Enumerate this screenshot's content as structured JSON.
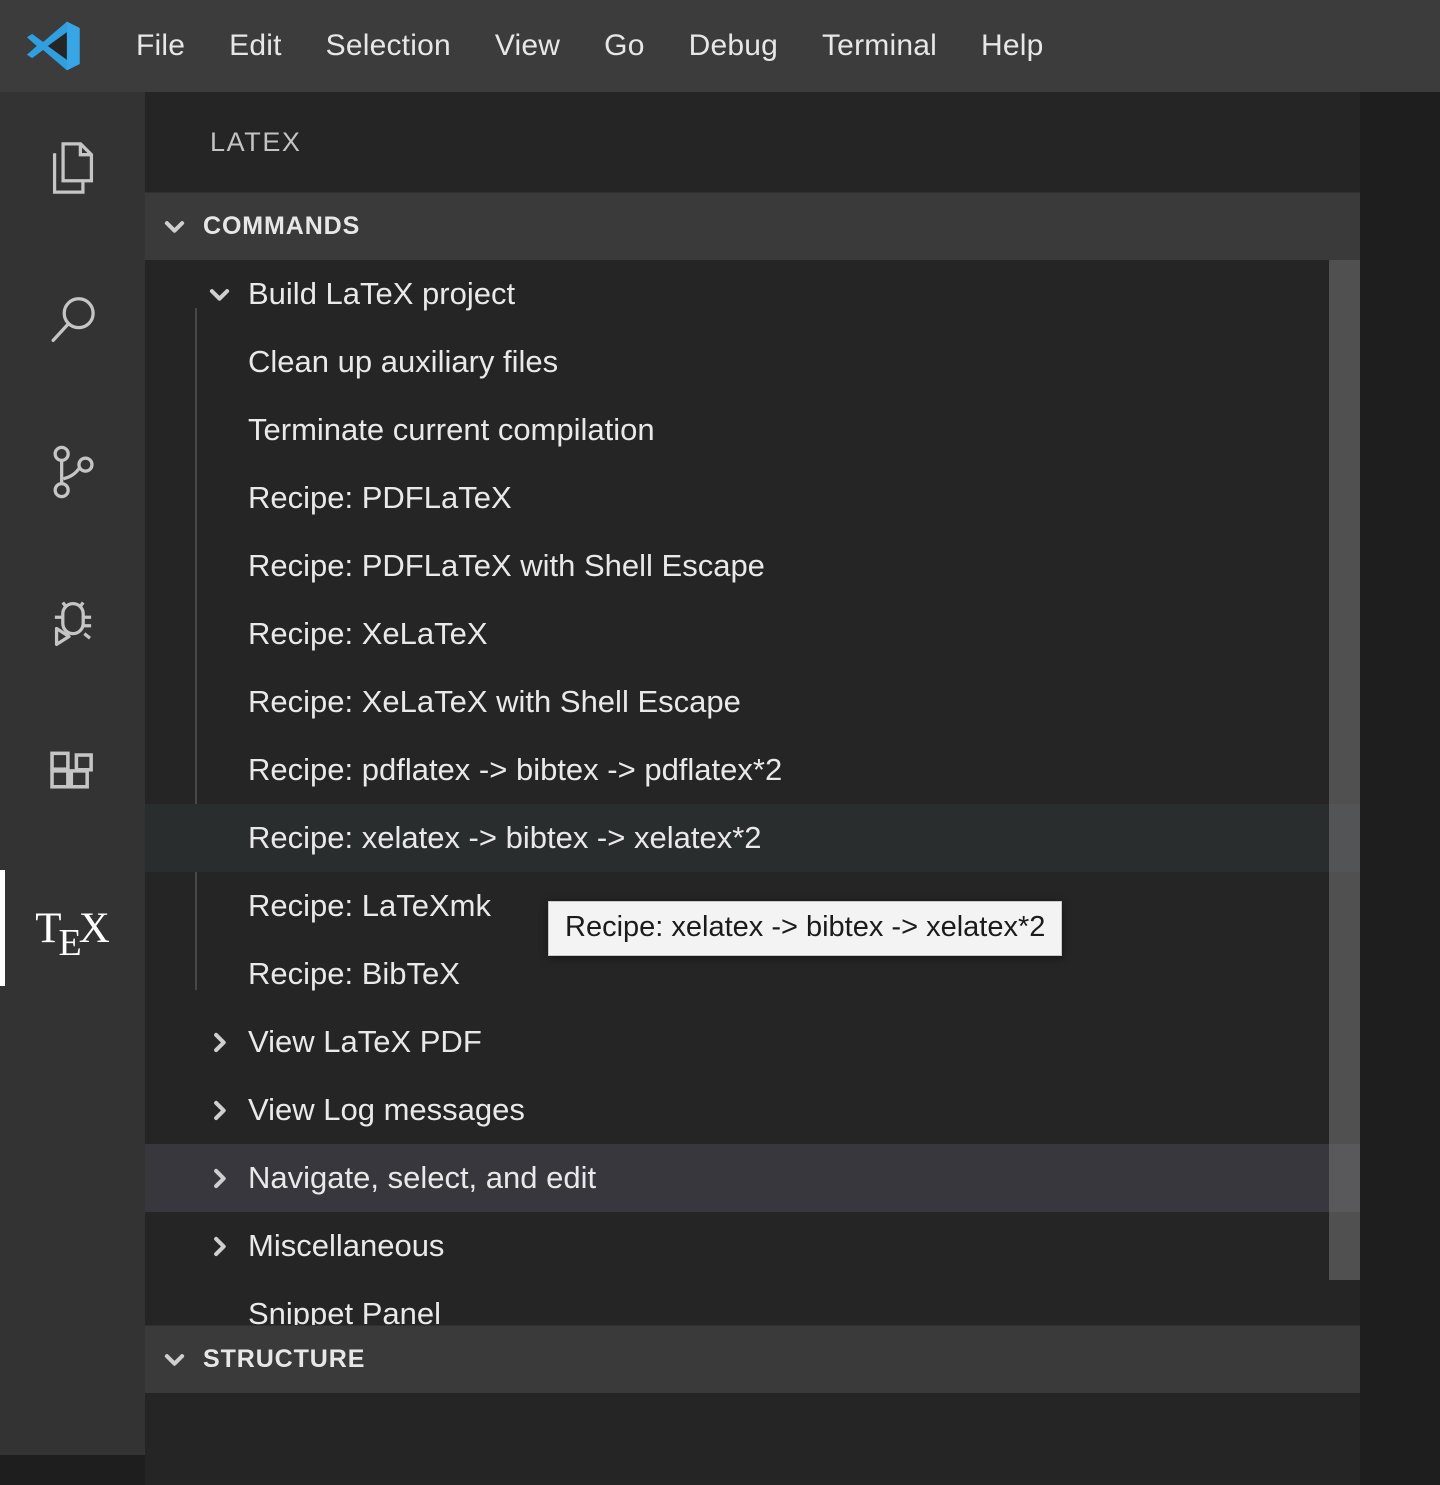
{
  "menubar": {
    "logo_icon": "vscode-logo-icon",
    "items": [
      {
        "label": "File"
      },
      {
        "label": "Edit"
      },
      {
        "label": "Selection"
      },
      {
        "label": "View"
      },
      {
        "label": "Go"
      },
      {
        "label": "Debug"
      },
      {
        "label": "Terminal"
      },
      {
        "label": "Help"
      }
    ]
  },
  "activitybar": {
    "items": [
      {
        "name": "explorer",
        "icon": "files-icon",
        "active": false
      },
      {
        "name": "search",
        "icon": "search-icon",
        "active": false
      },
      {
        "name": "source-control",
        "icon": "source-control-icon",
        "active": false
      },
      {
        "name": "run-and-debug",
        "icon": "debug-icon",
        "active": false
      },
      {
        "name": "extensions",
        "icon": "extensions-icon",
        "active": false
      },
      {
        "name": "latex",
        "icon": "tex-icon",
        "label": "TeX",
        "active": true
      }
    ]
  },
  "panel": {
    "title": "LATEX",
    "sections": [
      {
        "label": "COMMANDS",
        "expanded": true,
        "twisty": "chevron-down-icon"
      },
      {
        "label": "STRUCTURE",
        "expanded": true,
        "twisty": "chevron-down-icon"
      }
    ]
  },
  "tree": {
    "rows": [
      {
        "label": "Build LaTeX project",
        "depth": 1,
        "twisty": "chevron-down-icon",
        "state": "normal"
      },
      {
        "label": "Clean up auxiliary files",
        "depth": 2,
        "twisty": "none",
        "state": "normal"
      },
      {
        "label": "Terminate current compilation",
        "depth": 2,
        "twisty": "none",
        "state": "normal"
      },
      {
        "label": "Recipe: PDFLaTeX",
        "depth": 2,
        "twisty": "none",
        "state": "normal"
      },
      {
        "label": "Recipe: PDFLaTeX with Shell Escape",
        "depth": 2,
        "twisty": "none",
        "state": "normal"
      },
      {
        "label": "Recipe: XeLaTeX",
        "depth": 2,
        "twisty": "none",
        "state": "normal"
      },
      {
        "label": "Recipe: XeLaTeX with Shell Escape",
        "depth": 2,
        "twisty": "none",
        "state": "normal"
      },
      {
        "label": "Recipe: pdflatex -> bibtex -> pdflatex*2",
        "depth": 2,
        "twisty": "none",
        "state": "normal"
      },
      {
        "label": "Recipe: xelatex -> bibtex -> xelatex*2",
        "depth": 2,
        "twisty": "none",
        "state": "hovered"
      },
      {
        "label": "Recipe: LaTeXmk",
        "depth": 2,
        "twisty": "none",
        "state": "normal"
      },
      {
        "label": "Recipe: BibTeX",
        "depth": 2,
        "twisty": "none",
        "state": "normal"
      },
      {
        "label": "View LaTeX PDF",
        "depth": 1,
        "twisty": "chevron-right-icon",
        "state": "normal"
      },
      {
        "label": "View Log messages",
        "depth": 1,
        "twisty": "chevron-right-icon",
        "state": "normal"
      },
      {
        "label": "Navigate, select, and edit",
        "depth": 1,
        "twisty": "chevron-right-icon",
        "state": "selected"
      },
      {
        "label": "Miscellaneous",
        "depth": 1,
        "twisty": "chevron-right-icon",
        "state": "normal"
      },
      {
        "label": "Snippet Panel",
        "depth": 1,
        "twisty": "none",
        "state": "normal"
      }
    ]
  },
  "tooltip": {
    "text": "Recipe: xelatex -> bibtex -> xelatex*2"
  },
  "colors": {
    "menubar_bg": "#3c3c3c",
    "activitybar_bg": "#333333",
    "panel_bg": "#252526",
    "section_header_bg": "#3a3a3a",
    "row_hover_bg": "#2a2d2e",
    "row_selected_bg": "#37373d",
    "text": "#e9e9e9",
    "tooltip_bg": "#f3f3f3",
    "tooltip_text": "#1b1b1b",
    "active_indicator": "#ffffff",
    "logo_blue": "#2f9fe0"
  }
}
